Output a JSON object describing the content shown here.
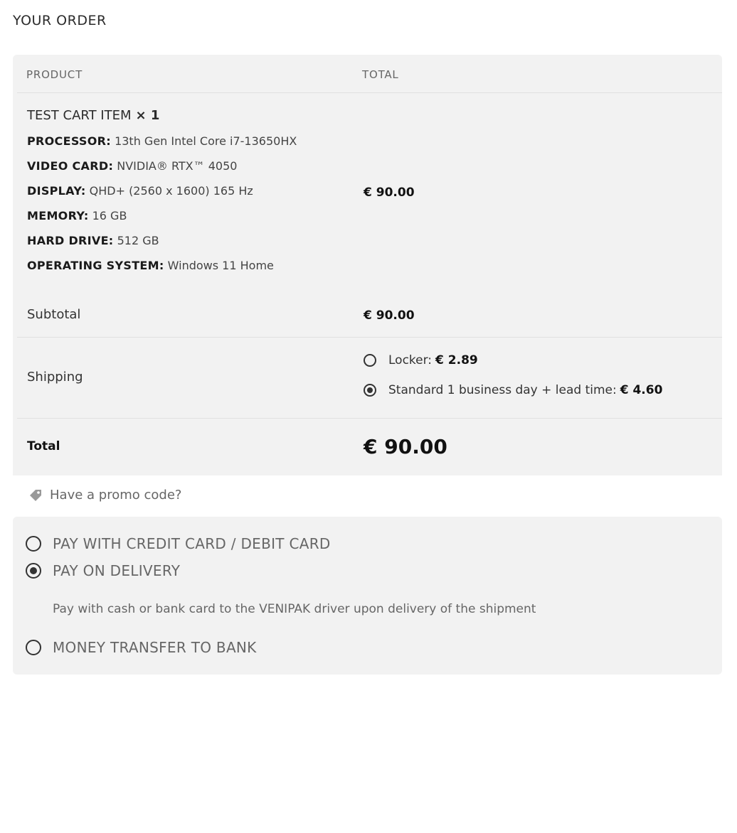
{
  "heading": "YOUR ORDER",
  "table": {
    "col_product": "PRODUCT",
    "col_total": "TOTAL"
  },
  "item": {
    "name": "TEST CART ITEM",
    "qty": "× 1",
    "price": "€ 90.00",
    "attributes": [
      {
        "key": "PROCESSOR:",
        "value": "13th Gen Intel Core i7-13650HX"
      },
      {
        "key": "VIDEO CARD:",
        "value": "NVIDIA® RTX™ 4050"
      },
      {
        "key": "DISPLAY:",
        "value": "QHD+ (2560 x 1600) 165 Hz"
      },
      {
        "key": "MEMORY:",
        "value": "16 GB"
      },
      {
        "key": "HARD DRIVE:",
        "value": "512 GB"
      },
      {
        "key": "OPERATING SYSTEM:",
        "value": "Windows 11 Home"
      }
    ]
  },
  "subtotal": {
    "label": "Subtotal",
    "value": "€ 90.00"
  },
  "shipping": {
    "label": "Shipping",
    "options": [
      {
        "label": "Locker:",
        "price": "€ 2.89",
        "selected": false
      },
      {
        "label": "Standard 1 business day + lead time:",
        "price": "€ 4.60",
        "selected": true
      }
    ]
  },
  "total": {
    "label": "Total",
    "value": "€ 90.00"
  },
  "promo": {
    "label": "Have a promo code?",
    "icon": "tag-icon"
  },
  "payment": {
    "options": [
      {
        "label": "PAY WITH CREDIT CARD / DEBIT CARD",
        "selected": false
      },
      {
        "label": "PAY ON DELIVERY",
        "selected": true
      },
      {
        "label": "MONEY TRANSFER TO BANK",
        "selected": false
      }
    ],
    "description": "Pay with cash or bank card to the VENIPAK driver upon delivery of the shipment"
  }
}
